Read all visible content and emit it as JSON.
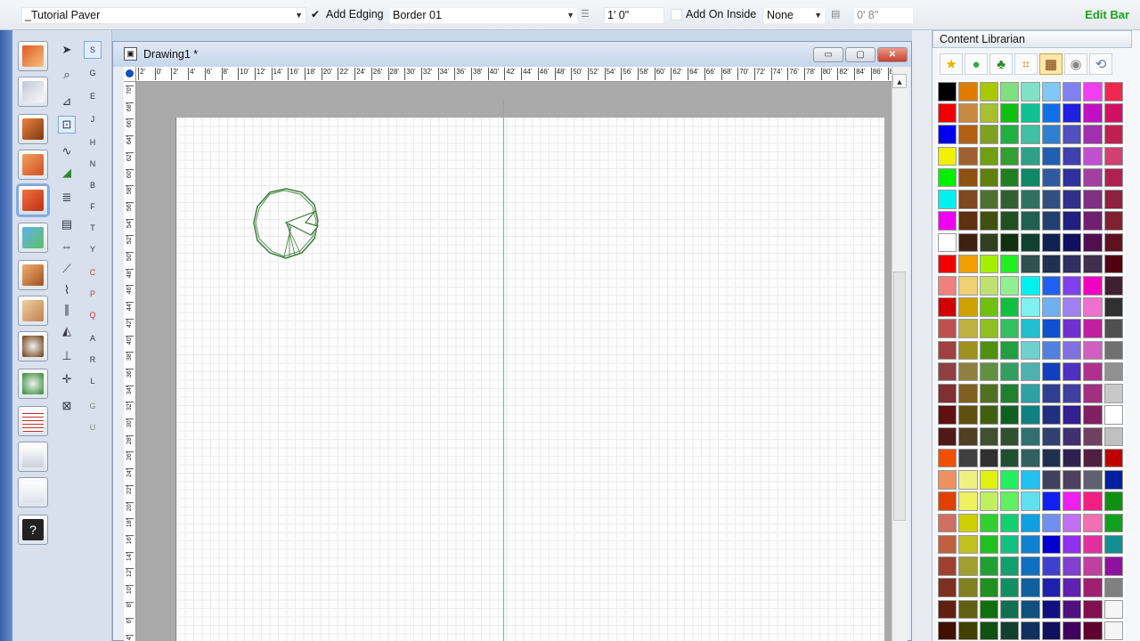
{
  "propbar": {
    "style_value": "_Tutorial Paver",
    "add_edging_checked": true,
    "add_edging_label": "Add Edging",
    "border_value": "Border 01",
    "width_value": "1' 0\"",
    "add_on_inside_label": "Add On Inside",
    "inside_value": "None",
    "offset_value": "0' 8\"",
    "edit_bar_label": "Edit Bar"
  },
  "drawing": {
    "title": "Drawing1 *",
    "min_label": "▭",
    "restore_label": "▢",
    "close_label": "✕",
    "hruler_ticks": [
      "2'",
      "0'",
      "2'",
      "4'",
      "6'",
      "8'",
      "10'",
      "12'",
      "14'",
      "16'",
      "18'",
      "20'",
      "22'",
      "24'",
      "26'",
      "28'",
      "30'",
      "32'",
      "34'",
      "36'",
      "38'",
      "40'",
      "42'",
      "44'",
      "46'",
      "48'",
      "50'",
      "52'",
      "54'",
      "56'",
      "58'",
      "60'",
      "62'",
      "64'",
      "66'",
      "68'",
      "70'",
      "72'",
      "74'",
      "76'",
      "78'",
      "80'",
      "82'",
      "84'",
      "86'",
      "88'"
    ],
    "vruler_ticks": [
      "70'",
      "68'",
      "66'",
      "64'",
      "62'",
      "60'",
      "58'",
      "56'",
      "54'",
      "52'",
      "50'",
      "48'",
      "46'",
      "44'",
      "42'",
      "40'",
      "38'",
      "36'",
      "34'",
      "32'",
      "30'",
      "28'",
      "26'",
      "24'",
      "22'",
      "20'",
      "18'",
      "16'",
      "14'",
      "12'",
      "10'",
      "8'",
      "6'",
      "4'"
    ]
  },
  "librarian": {
    "title": "Content Librarian",
    "tabs": [
      {
        "name": "favorites-tab",
        "icon": "star-icon",
        "glyph": "★",
        "color": "#e8b400"
      },
      {
        "name": "plants-tab",
        "icon": "leaf-icon",
        "glyph": "●",
        "color": "#3aa64a"
      },
      {
        "name": "trees-tab",
        "icon": "tree-icon",
        "glyph": "♣",
        "color": "#2d8a2d"
      },
      {
        "name": "landscape-tab",
        "icon": "frame-icon",
        "glyph": "⌗",
        "color": "#c98a1a"
      },
      {
        "name": "materials-tab",
        "icon": "brick-icon",
        "glyph": "▦",
        "color": "#7a3a10",
        "selected": true
      },
      {
        "name": "objects-tab",
        "icon": "camera-icon",
        "glyph": "◉",
        "color": "#888888"
      },
      {
        "name": "refresh-tab",
        "icon": "refresh-icon",
        "glyph": "⟲",
        "color": "#6677aa"
      }
    ],
    "swatches": [
      "#000000",
      "#e07b00",
      "#a8c800",
      "#7ee07e",
      "#80e0c8",
      "#80c8f8",
      "#8080f0",
      "#f040f0",
      "#f02850",
      "#f00000",
      "#c88a40",
      "#a8c030",
      "#10c010",
      "#10c090",
      "#1070e8",
      "#2020e0",
      "#c010c0",
      "#d01060",
      "#0000f0",
      "#b06010",
      "#80a020",
      "#20b040",
      "#40c0a0",
      "#3080d0",
      "#5050c0",
      "#a030b0",
      "#c02050",
      "#f0f000",
      "#a06030",
      "#70a010",
      "#30a030",
      "#30a088",
      "#2060b0",
      "#4040b0",
      "#c050d0",
      "#d04070",
      "#00f000",
      "#905010",
      "#608010",
      "#208020",
      "#108868",
      "#305aa0",
      "#3030a0",
      "#a040a0",
      "#b02050",
      "#00f0f0",
      "#804820",
      "#507030",
      "#306030",
      "#307060",
      "#305080",
      "#30308a",
      "#803080",
      "#902040",
      "#f000f0",
      "#603010",
      "#405010",
      "#205020",
      "#206050",
      "#204070",
      "#202080",
      "#702070",
      "#802030",
      "#ffffff",
      "#402010",
      "#304020",
      "#103010",
      "#104030",
      "#102050",
      "#101060",
      "#501050",
      "#601020",
      "#f00000",
      "#f0a000",
      "#a0f000",
      "#20f020",
      "#305050",
      "#203050",
      "#303060",
      "#403050",
      "#500010",
      "#f08080",
      "#f0d070",
      "#c0e070",
      "#90f090",
      "#00f0f0",
      "#2060f0",
      "#8040f0",
      "#f000c0",
      "#402030",
      "#d00000",
      "#d0a000",
      "#70c010",
      "#10c040",
      "#80f0f0",
      "#70b0f0",
      "#a080f0",
      "#f070d0",
      "#303030",
      "#c05050",
      "#c0b040",
      "#90c020",
      "#30c060",
      "#20c0d0",
      "#1050d0",
      "#7030d0",
      "#c020a0",
      "#505050",
      "#a04040",
      "#a09020",
      "#509010",
      "#20a040",
      "#70d0d0",
      "#5080e0",
      "#8070e0",
      "#d060c0",
      "#707070",
      "#904040",
      "#908040",
      "#609040",
      "#30a060",
      "#50b0b0",
      "#1040c0",
      "#5030c0",
      "#b03090",
      "#909090",
      "#803030",
      "#806020",
      "#507020",
      "#208030",
      "#30a0a0",
      "#304090",
      "#4040a0",
      "#a03080",
      "#c8c8c8",
      "#601010",
      "#605010",
      "#406010",
      "#106020",
      "#108080",
      "#203080",
      "#302090",
      "#802060",
      "#ffffff",
      "#501818",
      "#504020",
      "#405030",
      "#305030",
      "#307070",
      "#304070",
      "#403070",
      "#704060",
      "#c0c0c0",
      "#f05000",
      "#404040",
      "#303030",
      "#205030",
      "#306060",
      "#203050",
      "#302050",
      "#502040",
      "#c00000",
      "#f09060",
      "#f0f080",
      "#e0f010",
      "#20f060",
      "#20c0f0",
      "#404060",
      "#504060",
      "#606070",
      "#0020a0",
      "#e04000",
      "#f0f060",
      "#c0f060",
      "#60f060",
      "#60e0f0",
      "#1020f0",
      "#f020f0",
      "#f02080",
      "#109010",
      "#d07060",
      "#d0d000",
      "#30d030",
      "#10d070",
      "#10a0e0",
      "#7090f0",
      "#c070f0",
      "#f070b0",
      "#10a020",
      "#c06040",
      "#c0c020",
      "#20c020",
      "#10c080",
      "#1080d0",
      "#0000d0",
      "#9030f0",
      "#e030a0",
      "#109090",
      "#a04030",
      "#a0a030",
      "#20a030",
      "#10a070",
      "#1070c0",
      "#4040d0",
      "#8040d0",
      "#c040a0",
      "#9010a0",
      "#803020",
      "#808020",
      "#209020",
      "#109060",
      "#1060a0",
      "#2020b0",
      "#6020b0",
      "#a02070",
      "#808080",
      "#602010",
      "#606010",
      "#107010",
      "#107050",
      "#105080",
      "#101080",
      "#501080",
      "#801050",
      "#f5f5f5",
      "#401000",
      "#404000",
      "#105010",
      "#104030",
      "#103060",
      "#101060",
      "#400060",
      "#600030",
      "#f5f5f5"
    ]
  }
}
